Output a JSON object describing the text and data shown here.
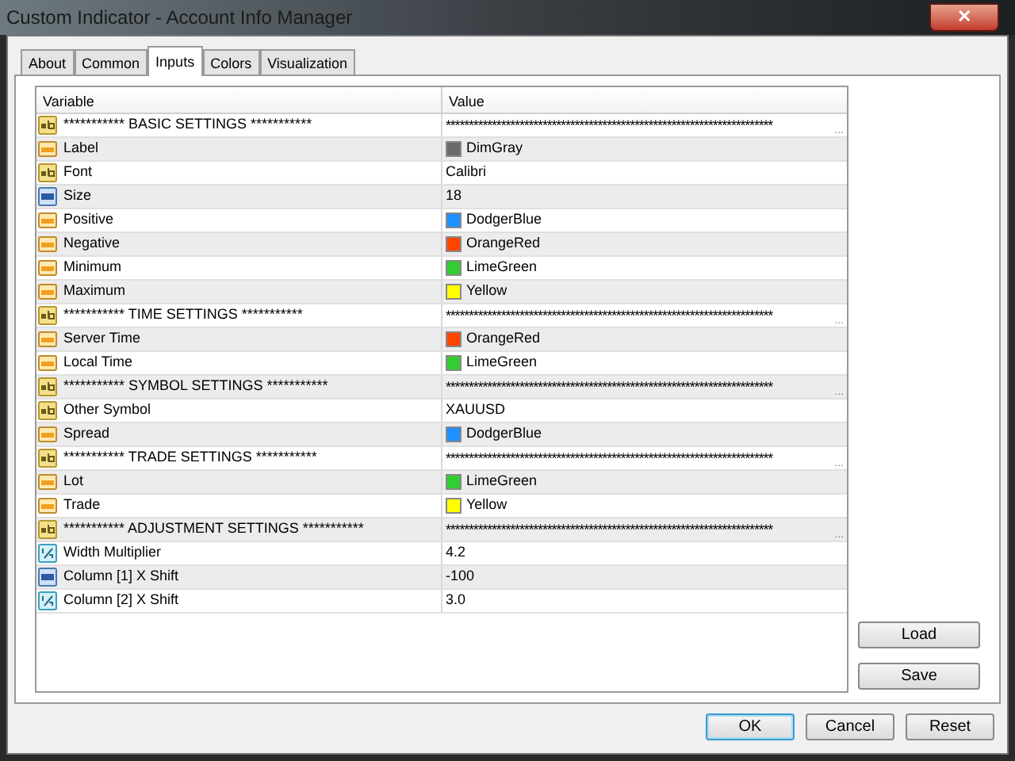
{
  "window": {
    "title": "Custom Indicator - Account  Info Manager",
    "close": "✕"
  },
  "tabs": [
    {
      "label": "About",
      "selected": false
    },
    {
      "label": "Common",
      "selected": false
    },
    {
      "label": "Inputs",
      "selected": true
    },
    {
      "label": "Colors",
      "selected": false
    },
    {
      "label": "Visualization",
      "selected": false
    }
  ],
  "table": {
    "columns": [
      "Variable",
      "Value"
    ],
    "rows": [
      {
        "kind": "section",
        "variable": "*********** BASIC SETTINGS ***********",
        "value": "***********************************************************************",
        "more": "..."
      },
      {
        "kind": "color",
        "variable": "Label",
        "value": "DimGray",
        "color": "#696969"
      },
      {
        "kind": "string",
        "variable": "Font",
        "value": "Calibri"
      },
      {
        "kind": "int",
        "variable": "Size",
        "value": "18"
      },
      {
        "kind": "color",
        "variable": "Positive",
        "value": "DodgerBlue",
        "color": "#1e90ff"
      },
      {
        "kind": "color",
        "variable": "Negative",
        "value": "OrangeRed",
        "color": "#ff4500"
      },
      {
        "kind": "color",
        "variable": "Minimum",
        "value": "LimeGreen",
        "color": "#32cd32"
      },
      {
        "kind": "color",
        "variable": "Maximum",
        "value": "Yellow",
        "color": "#ffff00"
      },
      {
        "kind": "section",
        "variable": "*********** TIME SETTINGS ***********",
        "value": "***********************************************************************",
        "more": "..."
      },
      {
        "kind": "color",
        "variable": "Server Time",
        "value": "OrangeRed",
        "color": "#ff4500"
      },
      {
        "kind": "color",
        "variable": "Local Time",
        "value": "LimeGreen",
        "color": "#32cd32"
      },
      {
        "kind": "section",
        "variable": "*********** SYMBOL SETTINGS ***********",
        "value": "***********************************************************************",
        "more": "..."
      },
      {
        "kind": "string",
        "variable": "Other Symbol",
        "value": "XAUUSD"
      },
      {
        "kind": "color",
        "variable": "Spread",
        "value": "DodgerBlue",
        "color": "#1e90ff"
      },
      {
        "kind": "section",
        "variable": "*********** TRADE SETTINGS ***********",
        "value": "***********************************************************************",
        "more": "..."
      },
      {
        "kind": "color",
        "variable": "Lot",
        "value": "LimeGreen",
        "color": "#32cd32"
      },
      {
        "kind": "color",
        "variable": "Trade",
        "value": "Yellow",
        "color": "#ffff00"
      },
      {
        "kind": "section",
        "variable": "*********** ADJUSTMENT SETTINGS ***********",
        "value": "***********************************************************************",
        "more": "..."
      },
      {
        "kind": "double",
        "variable": "Width Multiplier",
        "value": "4.2"
      },
      {
        "kind": "int",
        "variable": "Column [1] X Shift",
        "value": "-100"
      },
      {
        "kind": "double",
        "variable": "Column [2] X Shift",
        "value": "3.0"
      }
    ]
  },
  "side_buttons": [
    "Load",
    "Save"
  ],
  "buttons": [
    {
      "label": "OK",
      "selected": true
    },
    {
      "label": "Cancel",
      "selected": false
    },
    {
      "label": "Reset",
      "selected": false
    }
  ]
}
